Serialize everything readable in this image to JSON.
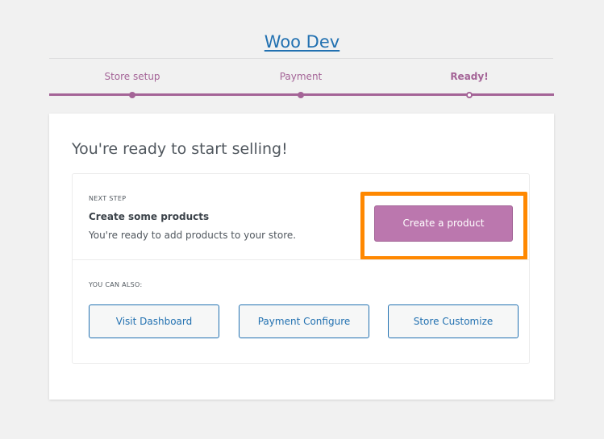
{
  "site": {
    "title": "Woo Dev"
  },
  "steps": [
    {
      "label": "Store setup",
      "state": "done"
    },
    {
      "label": "Payment",
      "state": "done"
    },
    {
      "label": "Ready!",
      "state": "active"
    }
  ],
  "card": {
    "heading": "You're ready to start selling!",
    "next_step": {
      "label": "NEXT STEP",
      "title": "Create some products",
      "description": "You're ready to add products to your store.",
      "button_label": "Create a product"
    },
    "also": {
      "label": "YOU CAN ALSO:",
      "buttons": [
        {
          "label": "Visit Dashboard"
        },
        {
          "label": "Payment Configure"
        },
        {
          "label": "Store Customize"
        }
      ]
    }
  },
  "colors": {
    "accent": "#a46497",
    "primary_button": "#bb77ae",
    "link": "#2271b1",
    "highlight": "#ff8800"
  }
}
